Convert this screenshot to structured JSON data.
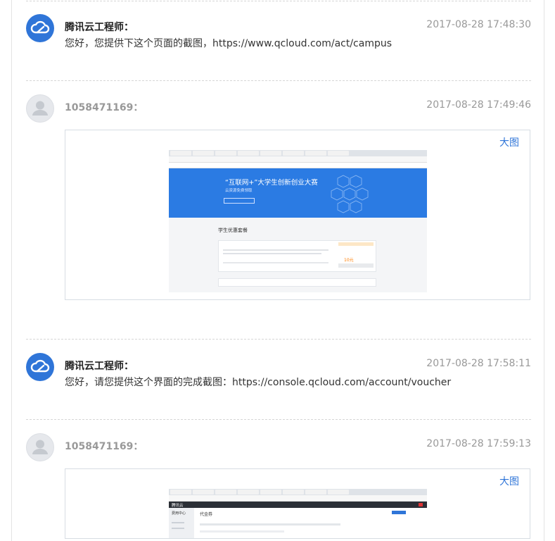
{
  "messages": [
    {
      "author": "腾讯云工程师：",
      "time": "2017-08-28 17:48:30",
      "text": "您好，您提供下这个页面的截图，https://www.qcloud.com/act/campus"
    },
    {
      "author": "1058471169：",
      "time": "2017-08-28 17:49:46",
      "image_link": "大图",
      "screenshot": {
        "banner_title": "“互联网+”大学生创新创业大赛",
        "banner_sub": "云资源免费领取",
        "section_title": "学生优惠套餐",
        "price": "10元"
      }
    },
    {
      "author": "腾讯云工程师：",
      "time": "2017-08-28 17:58:11",
      "text": "您好，请您提供这个界面的完成截图：https://console.qcloud.com/account/voucher"
    },
    {
      "author": "1058471169：",
      "time": "2017-08-28 17:59:13",
      "image_link": "大图",
      "screenshot": {
        "console_logo": "腾讯云",
        "side_title": "费用中心",
        "page_title": "代金券"
      }
    }
  ],
  "colors": {
    "accent": "#2f75d8",
    "muted": "#999999",
    "separator": "#d6d6d6",
    "banner_blue": "#2b7be3",
    "console_dark": "#2b2f36"
  },
  "icons": {
    "engineer_avatar": "cloud-logo-icon",
    "user_avatar": "default-user-icon"
  }
}
